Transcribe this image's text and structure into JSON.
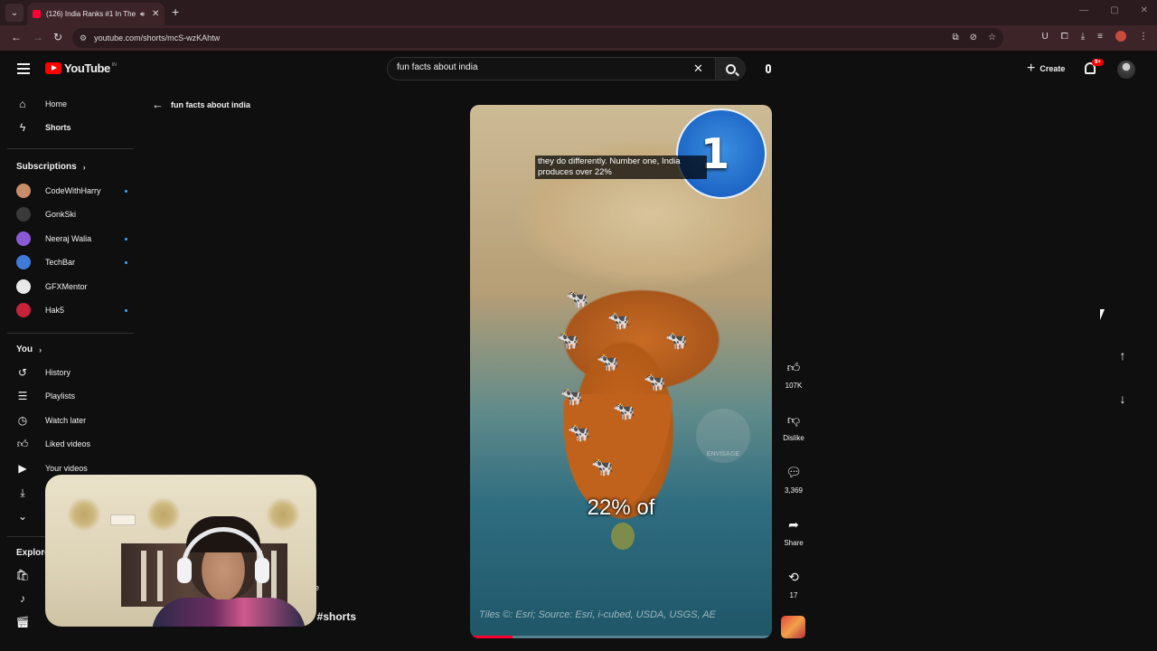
{
  "browser": {
    "tab_title": "(126) India Ranks #1 In The",
    "url": "youtube.com/shorts/mcS-wzKAhtw"
  },
  "header": {
    "logo_text": "YouTube",
    "country_code": "IN",
    "search_value": "fun facts about india",
    "search_placeholder": "Search",
    "create_label": "Create",
    "notification_count": "9+"
  },
  "sidebar": {
    "main": [
      {
        "label": "Home",
        "icon": "home-icon"
      },
      {
        "label": "Shorts",
        "icon": "shorts-icon"
      }
    ],
    "subscriptions_heading": "Subscriptions",
    "subscriptions": [
      {
        "label": "CodeWithHarry",
        "color": "#c98c6a",
        "new": true
      },
      {
        "label": "GonkSki",
        "color": "#3a3a3a",
        "new": false
      },
      {
        "label": "Neeraj Walia",
        "color": "#8a5ad6",
        "new": true
      },
      {
        "label": "TechBar",
        "color": "#3f7bd6",
        "new": true
      },
      {
        "label": "GFXMentor",
        "color": "#e8e8e8",
        "new": false
      },
      {
        "label": "Hak5",
        "color": "#c8223a",
        "new": true
      }
    ],
    "you_heading": "You",
    "you": [
      {
        "label": "History",
        "icon": "history-icon"
      },
      {
        "label": "Playlists",
        "icon": "playlists-icon"
      },
      {
        "label": "Watch later",
        "icon": "watch-later-icon"
      },
      {
        "label": "Liked videos",
        "icon": "liked-videos-icon"
      },
      {
        "label": "Your videos",
        "icon": "your-videos-icon"
      }
    ],
    "explore_heading": "Explore"
  },
  "main": {
    "back_label": "fun facts about india",
    "video_caption": "they do differently. Number one, India produces over 22%",
    "rank_number": "1",
    "big_caption": "22% of",
    "watermark_text": "ENVISAGE",
    "tiles_credit": "Tiles ©: Esri; Source: Esri, i-cubed, USDA, USGS, AE",
    "progress": 0.14,
    "short_title_fragment": "? #shorts",
    "overlay_letter": "e"
  },
  "actions": {
    "like_count": "107K",
    "dislike_label": "Dislike",
    "comment_count": "3,369",
    "share_label": "Share",
    "remix_count": "17"
  }
}
